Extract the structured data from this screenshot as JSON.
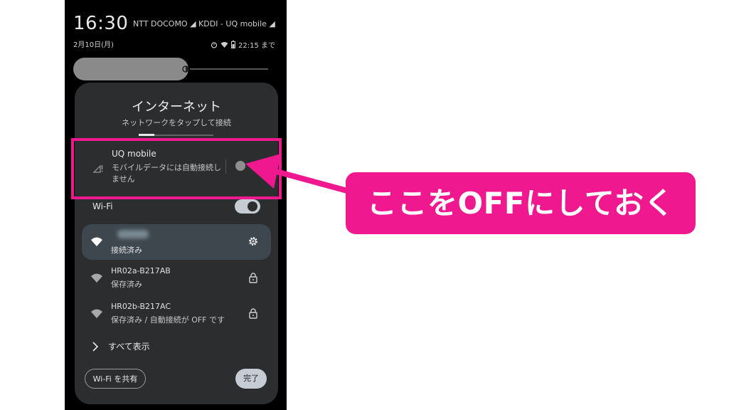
{
  "status_bar": {
    "time": "16:30",
    "carriers": "NTT DOCOMO ◢ KDDI - UQ mobile ◢",
    "date": "2月10日(月)",
    "alarm": "22:15 まで"
  },
  "internet_panel": {
    "title": "インターネット",
    "subtitle": "ネットワークをタップして接続",
    "mobile": {
      "name": "UQ mobile",
      "description": "モバイルデータには自動接続しません"
    },
    "wifi_label": "Wi-Fi",
    "networks": [
      {
        "name": "",
        "status": "接続済み"
      },
      {
        "name": "HR02a-B217AB",
        "status": "保存済み"
      },
      {
        "name": "HR02b-B217AC",
        "status": "保存済み / 自動接続が OFF です"
      }
    ],
    "show_all": "すべて表示",
    "share_button": "Wi-Fi を共有",
    "done_button": "完了"
  },
  "annotation": {
    "callout_text": "ここをOFFにしておく",
    "color": "#f0188f"
  }
}
